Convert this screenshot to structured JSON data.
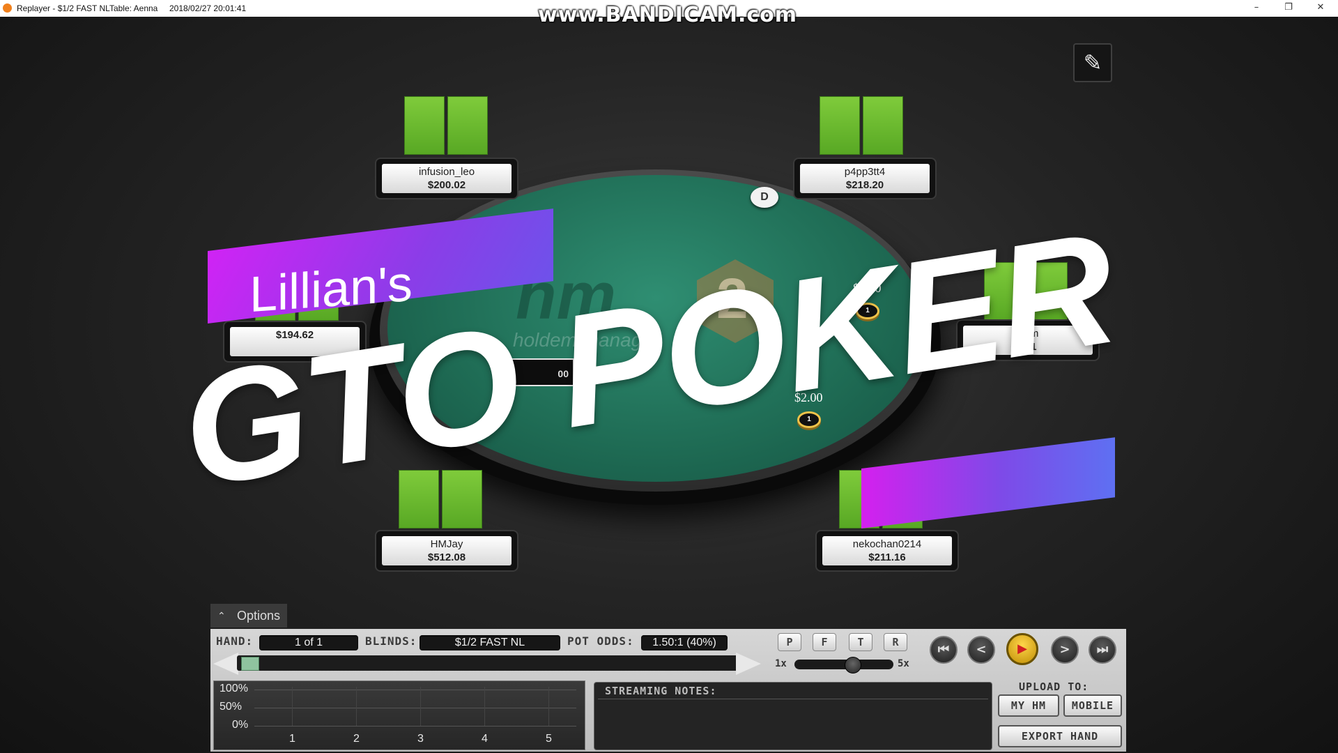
{
  "window": {
    "title": "Replayer - $1/2 FAST NLTable: Aenna     2018/02/27 20:01:41",
    "minimize": "–",
    "restore": "❐",
    "close": "✕"
  },
  "watermark": "www.BANDICAM.com",
  "table": {
    "logo": "hm",
    "logo_num": "2",
    "logo_sub": "holdem manager",
    "pot_partial": "00",
    "dealer": "D"
  },
  "players": [
    {
      "name": "infusion_leo",
      "stack": "$200.02"
    },
    {
      "name": "p4pp3tt4",
      "stack": "$218.20"
    },
    {
      "name": "",
      "stack": "$194.62"
    },
    {
      "name": "Kem",
      "stack": "$21"
    },
    {
      "name": "HMJay",
      "stack": "$512.08"
    },
    {
      "name": "nekochan0214",
      "stack": "$211.16"
    }
  ],
  "bets": [
    {
      "amount": "$1.00",
      "chip": "1"
    },
    {
      "amount": "$2.00",
      "chip": "1"
    }
  ],
  "overlay": {
    "subtitle": "Lillian's",
    "title": "GTO POKER"
  },
  "controls": {
    "options": "Options",
    "hand_label": "HAND:",
    "hand_value": "1 of 1",
    "blinds_label": "BLINDS:",
    "blinds_value": "$1/2 FAST NL",
    "pot_odds_label": "POT ODDS:",
    "pot_odds_value": "1.50:1 (40%)",
    "street_buttons": [
      "P",
      "F",
      "T",
      "R"
    ],
    "speed_min": "1x",
    "speed_max": "5x",
    "nav": {
      "first": "⏮",
      "prev": "<",
      "play": "▶",
      "next": ">",
      "last": "⏭"
    },
    "streaming_notes": "STREAMING NOTES:",
    "upload_to": "UPLOAD TO:",
    "my_hm": "MY HM",
    "mobile": "MOBILE",
    "export_hand": "EXPORT HAND"
  },
  "graph": {
    "y_labels": [
      "100%",
      "50%",
      "0%"
    ],
    "x_labels": [
      "1",
      "2",
      "3",
      "4",
      "5"
    ]
  },
  "colors": {
    "felt": "#1e6a53",
    "card_back": "#6cbc30",
    "banner": "#c526f2",
    "play_button": "#e0a810"
  }
}
